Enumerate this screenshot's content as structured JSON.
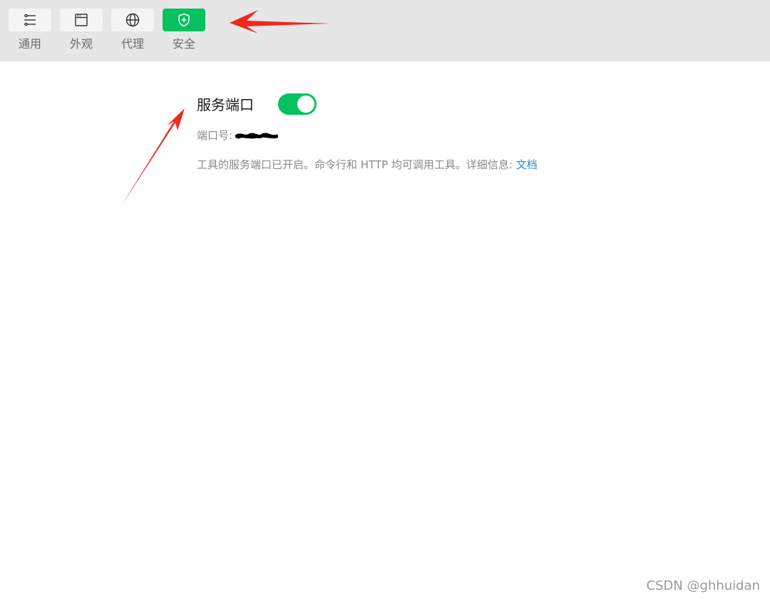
{
  "toolbar": {
    "tabs": [
      {
        "label": "通用",
        "icon": "sliders-icon"
      },
      {
        "label": "外观",
        "icon": "window-icon"
      },
      {
        "label": "代理",
        "icon": "globe-icon"
      },
      {
        "label": "安全",
        "icon": "shield-plus-icon",
        "active": true
      }
    ],
    "active_color": "#07c160"
  },
  "service_port": {
    "title": "服务端口",
    "enabled": true,
    "port_label": "端口号:",
    "description": "工具的服务端口已开启。命令行和 HTTP 均可调用工具。详细信息:",
    "doc_link": "文档"
  },
  "watermark": "CSDN @ghhuidan",
  "annotations": {
    "arrow_color": "#f0281e"
  }
}
